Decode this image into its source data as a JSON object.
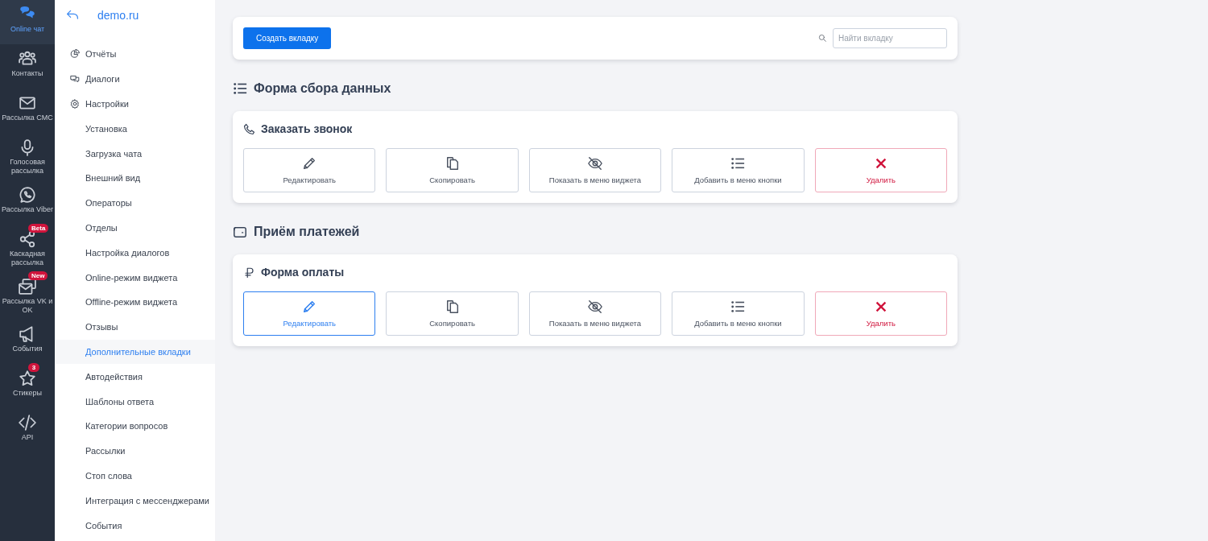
{
  "rail": [
    {
      "label": "Online чат",
      "selected": true
    },
    {
      "label": "Контакты",
      "selected": false
    },
    {
      "label": "Рассылка СМС",
      "selected": false
    },
    {
      "label": "Голосовая рассылка",
      "selected": false
    },
    {
      "label": "Рассылка Viber",
      "selected": false
    },
    {
      "label": "Каскадная рассылка",
      "badge": "Beta",
      "selected": false
    },
    {
      "label": "Рассылка VK и OK",
      "badge": "New",
      "selected": false
    },
    {
      "label": "События",
      "selected": false
    },
    {
      "label": "Стикеры",
      "badge": "3",
      "selected": false
    },
    {
      "label": "API",
      "selected": false
    }
  ],
  "nav": {
    "site": "demo.ru",
    "items": [
      {
        "kind": "main",
        "label": "Отчёты",
        "selected": false
      },
      {
        "kind": "main",
        "label": "Диалоги",
        "selected": false
      },
      {
        "kind": "main",
        "label": "Настройки",
        "selected": false
      },
      {
        "kind": "sub",
        "label": "Установка",
        "selected": false
      },
      {
        "kind": "sub",
        "label": "Загрузка чата",
        "selected": false
      },
      {
        "kind": "sub",
        "label": "Внешний вид",
        "selected": false
      },
      {
        "kind": "sub",
        "label": "Операторы",
        "selected": false
      },
      {
        "kind": "sub",
        "label": "Отделы",
        "selected": false
      },
      {
        "kind": "sub",
        "label": "Настройка диалогов",
        "selected": false
      },
      {
        "kind": "sub",
        "label": "Online-режим виджета",
        "selected": false
      },
      {
        "kind": "sub",
        "label": "Offline-режим виджета",
        "selected": false
      },
      {
        "kind": "sub",
        "label": "Отзывы",
        "selected": false
      },
      {
        "kind": "sub",
        "label": "Дополнительные вкладки",
        "selected": true
      },
      {
        "kind": "sub",
        "label": "Автодействия",
        "selected": false
      },
      {
        "kind": "sub",
        "label": "Шаблоны ответа",
        "selected": false
      },
      {
        "kind": "sub",
        "label": "Категории вопросов",
        "selected": false
      },
      {
        "kind": "sub",
        "label": "Рассылки",
        "selected": false
      },
      {
        "kind": "sub",
        "label": "Стоп слова",
        "selected": false
      },
      {
        "kind": "sub",
        "label": "Интеграция с мессенджерами",
        "selected": false
      },
      {
        "kind": "sub",
        "label": "События",
        "selected": false
      }
    ]
  },
  "toolbar": {
    "create_button": "Создать вкладку",
    "search": {
      "placeholder": "Найти вкладку"
    }
  },
  "sections": [
    {
      "title": "Форма сбора данных",
      "cards": [
        {
          "title": "Заказать звонок",
          "actions": [
            {
              "kind": "edit",
              "label": "Редактировать",
              "highlighted": false
            },
            {
              "kind": "copy",
              "label": "Скопировать",
              "highlighted": false
            },
            {
              "kind": "hide",
              "label": "Показать в меню виджета",
              "highlighted": false
            },
            {
              "kind": "list",
              "label": "Добавить в меню кнопки",
              "highlighted": false
            },
            {
              "kind": "delete",
              "label": "Удалить",
              "highlighted": false
            }
          ]
        }
      ]
    },
    {
      "title": "Приём платежей",
      "cards": [
        {
          "title": "Форма оплаты",
          "actions": [
            {
              "kind": "edit",
              "label": "Редактировать",
              "highlighted": true
            },
            {
              "kind": "copy",
              "label": "Скопировать",
              "highlighted": false
            },
            {
              "kind": "hide",
              "label": "Показать в меню виджета",
              "highlighted": false
            },
            {
              "kind": "list",
              "label": "Добавить в меню кнопки",
              "highlighted": false
            },
            {
              "kind": "delete",
              "label": "Удалить",
              "highlighted": false
            }
          ]
        }
      ]
    }
  ]
}
